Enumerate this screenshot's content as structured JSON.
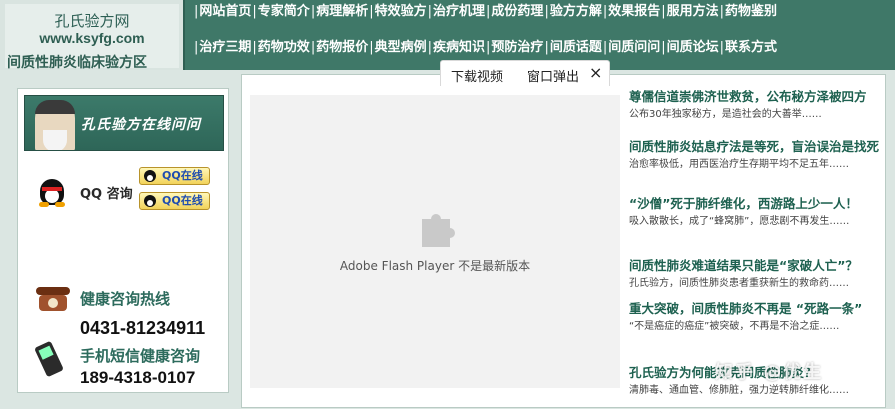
{
  "logo": {
    "line1": "孔氏验方网",
    "line2": "www.ksyfg.com",
    "line3": "间质性肺炎临床验方区"
  },
  "nav": {
    "row1": [
      "网站首页",
      "专家简介",
      "病理解析",
      "特效验方",
      "治疗机理",
      "成份药理",
      "验方方解",
      "效果报告",
      "服用方法",
      "药物鉴别"
    ],
    "row2": [
      "治疗三期",
      "药物功效",
      "药物报价",
      "典型病例",
      "疾病知识",
      "预防治疗",
      "间质话题",
      "间质问问",
      "间质论坛",
      "联系方式"
    ]
  },
  "video_bar": {
    "download": "下载视频",
    "popup": "窗口弹出",
    "close": "×"
  },
  "sidebar": {
    "banner_text": "孔氏验方在线问问",
    "qq_label": "QQ 咨询",
    "qq_button_1": "QQ在线",
    "qq_button_2": "QQ在线",
    "hotline_label": "健康咨询热线",
    "hotline_number": "0431-81234911",
    "sms_label": "手机短信健康咨询",
    "sms_number": "189-4318-0107"
  },
  "flash": {
    "message": "Adobe Flash Player 不是最新版本"
  },
  "news": [
    {
      "title": "尊儒信道崇佛济世救贫，公布秘方泽被四方",
      "desc": "公布30年独家秘方，是造社会的大善举……"
    },
    {
      "title": "间质性肺炎姑息疗法是等死，盲治误治是找死",
      "desc": "治愈率极低，用西医治疗生存期平均不足五年……"
    },
    {
      "title": "“沙僧”死于肺纤维化，西游路上少一人！",
      "desc": "吸入散散长，成了“蜂窝肺”，愿悲剧不再发生……"
    },
    {
      "title": "间质性肺炎难道结果只能是“家破人亡”？",
      "desc": "孔氏验方，间质性肺炎患者重获新生的救命药……"
    },
    {
      "title": "重大突破，间质性肺炎不再是 “死路一条”",
      "desc": "“不是癌症的癌症”被突破，不再是不治之症……"
    },
    {
      "title": "孔氏验方为何能攻克间质性肺炎？",
      "desc": "清肺毒、通血管、修肺脏，强力逆转肺纤维化……"
    }
  ],
  "watermark": "知乎 @优生"
}
